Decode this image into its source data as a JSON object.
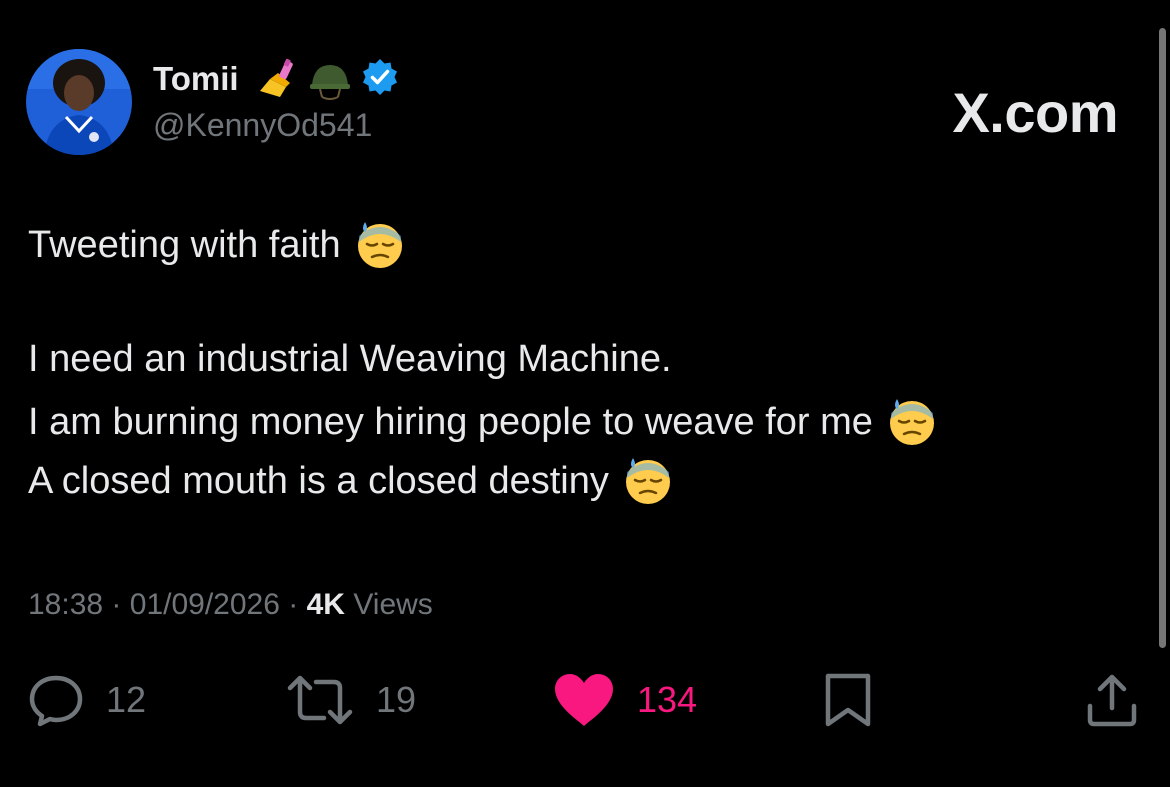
{
  "author": {
    "name": "Tomii",
    "handle": "@KennyOd541",
    "badges": [
      "nail-polish-icon",
      "military-helmet-icon",
      "verified-badge-icon"
    ]
  },
  "watermark": "X.com",
  "tweet": {
    "lines": [
      "Tweeting with faith",
      "I need an industrial Weaving Machine.",
      "I am burning money hiring people to weave for me",
      "A closed mouth is a closed destiny"
    ],
    "line_emoji": [
      "downcast-sweat-face-emoji",
      "",
      "downcast-sweat-face-emoji",
      "downcast-sweat-face-emoji"
    ]
  },
  "meta": {
    "time": "18:38",
    "separator": "·",
    "date": "01/09/2026",
    "views_count": "4K",
    "views_label": "Views"
  },
  "actions": {
    "reply_count": "12",
    "repost_count": "19",
    "like_count": "134",
    "icons": [
      "reply-icon",
      "repost-icon",
      "like-heart-icon",
      "bookmark-icon",
      "share-icon"
    ]
  },
  "colors": {
    "background": "#000000",
    "text": "#e7e9ea",
    "muted": "#71767b",
    "like": "#f91880",
    "verified": "#1d9bf0"
  }
}
